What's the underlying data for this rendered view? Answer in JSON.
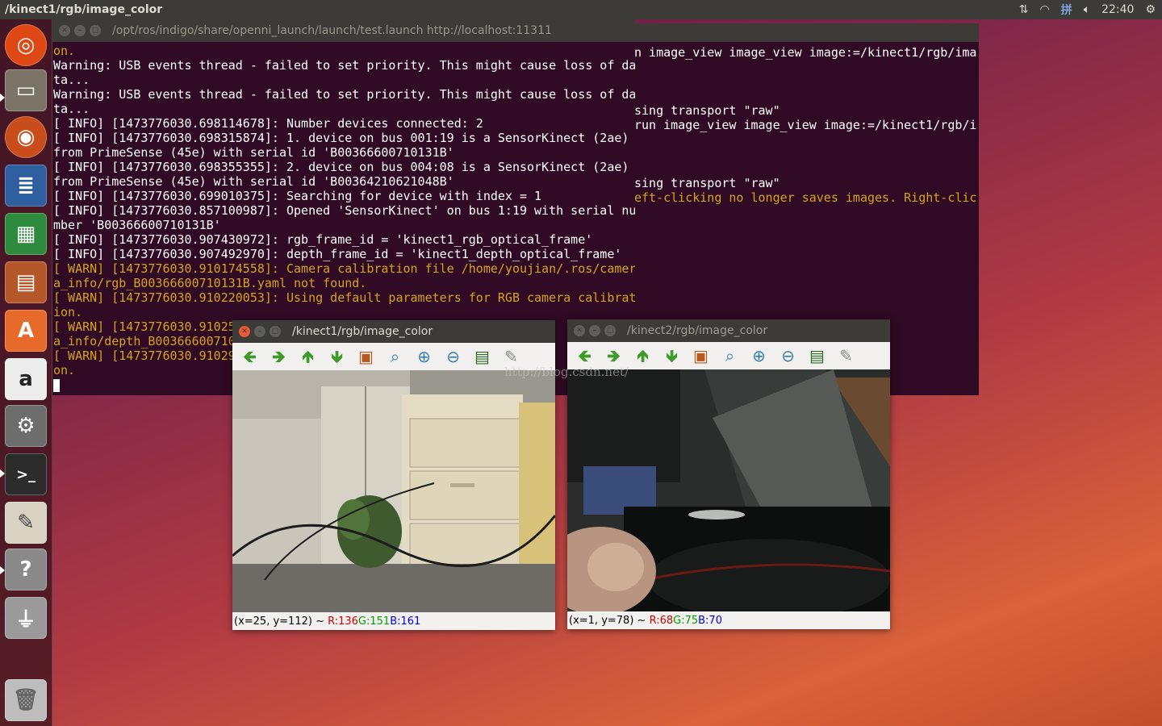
{
  "top_panel": {
    "window_title": "/kinect1/rgb/image_color",
    "clock": "22:40",
    "keyboard_indicator": "拼"
  },
  "launcher": {
    "items": [
      "ubuntu-dash",
      "files",
      "firefox",
      "libreoffice-writer",
      "libreoffice-calc",
      "libreoffice-impress",
      "software-center",
      "amazon",
      "system-settings",
      "terminal",
      "text-editor",
      "help",
      "usb-drive",
      "trash"
    ]
  },
  "terminal_front": {
    "title": "/opt/ros/indigo/share/openni_launch/launch/test.launch http://localhost:11311",
    "lines": [
      {
        "t": "on.",
        "warn": true
      },
      {
        "t": "Warning: USB events thread - failed to set priority. This might cause loss of da",
        "warn": false
      },
      {
        "t": "ta...",
        "warn": false
      },
      {
        "t": "Warning: USB events thread - failed to set priority. This might cause loss of da",
        "warn": false
      },
      {
        "t": "ta...",
        "warn": false
      },
      {
        "t": "[ INFO] [1473776030.698114678]: Number devices connected: 2",
        "warn": false
      },
      {
        "t": "[ INFO] [1473776030.698315874]: 1. device on bus 001:19 is a SensorKinect (2ae)",
        "warn": false
      },
      {
        "t": "from PrimeSense (45e) with serial id 'B00366600710131B'",
        "warn": false
      },
      {
        "t": "[ INFO] [1473776030.698355355]: 2. device on bus 004:08 is a SensorKinect (2ae)",
        "warn": false
      },
      {
        "t": "from PrimeSense (45e) with serial id 'B00364210621048B'",
        "warn": false
      },
      {
        "t": "[ INFO] [1473776030.699010375]: Searching for device with index = 1",
        "warn": false
      },
      {
        "t": "[ INFO] [1473776030.857100987]: Opened 'SensorKinect' on bus 1:19 with serial nu",
        "warn": false
      },
      {
        "t": "mber 'B00366600710131B'",
        "warn": false
      },
      {
        "t": "[ INFO] [1473776030.907430972]: rgb_frame_id = 'kinect1_rgb_optical_frame'",
        "warn": false
      },
      {
        "t": "[ INFO] [1473776030.907492970]: depth_frame_id = 'kinect1_depth_optical_frame'",
        "warn": false
      },
      {
        "t": "[ WARN] [1473776030.910174558]: Camera calibration file /home/youjian/.ros/camer",
        "warn": true
      },
      {
        "t": "a_info/rgb_B00366600710131B.yaml not found.",
        "warn": true
      },
      {
        "t": "[ WARN] [1473776030.910220053]: Using default parameters for RGB camera calibrat",
        "warn": true
      },
      {
        "t": "ion.",
        "warn": true
      },
      {
        "t": "[ WARN] [1473776030.91025",
        "warn": true
      },
      {
        "t": "a_info/depth_B00366600710",
        "warn": true
      },
      {
        "t": "[ WARN] [1473776030.91029",
        "warn": true
      },
      {
        "t": "on.",
        "warn": true
      }
    ]
  },
  "terminal_back": {
    "lines": [
      {
        "t": "n image_view image_view image:=/kinect1/rgb/ima",
        "warn": false
      },
      {
        "t": "",
        "warn": false
      },
      {
        "t": "",
        "warn": false
      },
      {
        "t": "",
        "warn": false
      },
      {
        "t": "sing transport \"raw\"",
        "warn": false
      },
      {
        "t": "run image_view image_view image:=/kinect1/rgb/i",
        "warn": false
      },
      {
        "t": "",
        "warn": false
      },
      {
        "t": "",
        "warn": false
      },
      {
        "t": "",
        "warn": false
      },
      {
        "t": "sing transport \"raw\"",
        "warn": false
      },
      {
        "t": "eft-clicking no longer saves images. Right-clic",
        "warn": true
      }
    ]
  },
  "image_window_1": {
    "title": "/kinect1/rgb/image_color",
    "status_coords": "(x=25, y=112) ~ ",
    "status_r": "R:136",
    "status_g": "G:151",
    "status_b": "B:161"
  },
  "image_window_2": {
    "title": "/kinect2/rgb/image_color",
    "status_coords": "(x=1, y=78) ~ ",
    "status_r": "R:68",
    "status_g": "G:75",
    "status_b": "B:70"
  },
  "watermark": "http://blog.csdn.net/",
  "toolbar_icons": [
    "arrow-left-icon",
    "arrow-right-icon",
    "arrow-up-icon",
    "arrow-down-icon",
    "image-icon",
    "zoom-fit-icon",
    "zoom-in-icon",
    "zoom-out-icon",
    "save-icon",
    "brush-icon"
  ]
}
